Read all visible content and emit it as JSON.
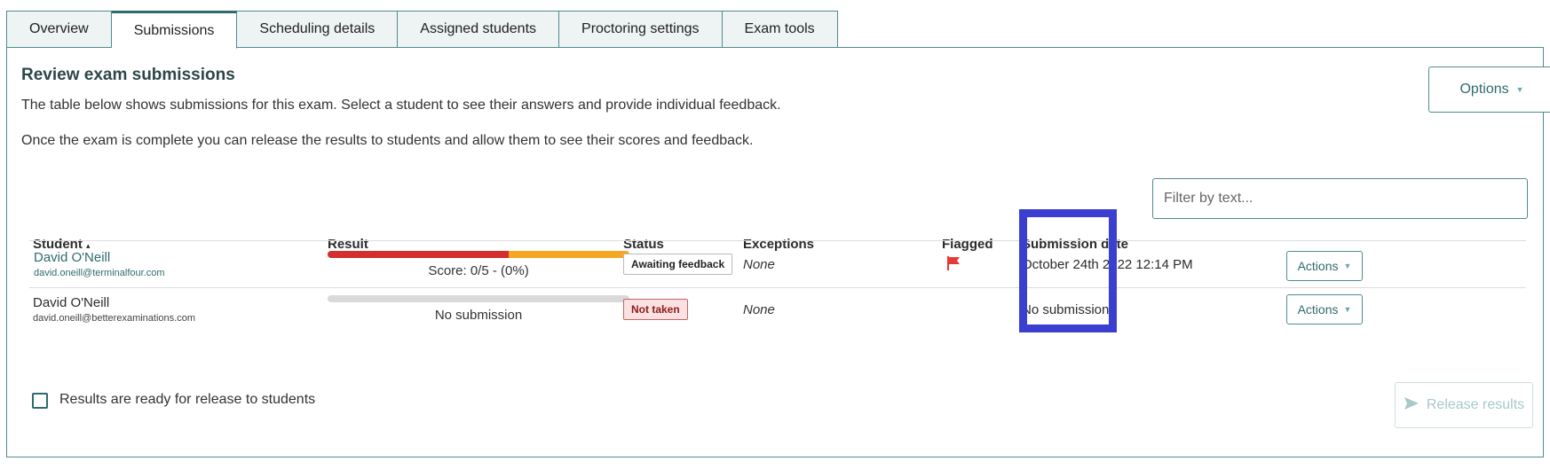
{
  "tabs": [
    {
      "label": "Overview"
    },
    {
      "label": "Submissions"
    },
    {
      "label": "Scheduling details"
    },
    {
      "label": "Assigned students"
    },
    {
      "label": "Proctoring settings"
    },
    {
      "label": "Exam tools"
    }
  ],
  "active_tab": "Submissions",
  "header": {
    "title": "Review exam submissions",
    "description1": "The table below shows submissions for this exam. Select a student to see their answers and provide individual feedback.",
    "description2": "Once the exam is complete you can release the results to students and allow them to see their scores and feedback.",
    "options_label": "Options"
  },
  "filter": {
    "placeholder": "Filter by text..."
  },
  "table": {
    "columns": {
      "student": "Student",
      "student_sort_icon": "▴",
      "result": "Result",
      "status": "Status",
      "exceptions": "Exceptions",
      "flagged": "Flagged",
      "submission_date": "Submission date"
    },
    "rows": [
      {
        "name": "David O'Neill",
        "email": "david.oneill@terminalfour.com",
        "result_text": "Score: 0/5 - (0%)",
        "result_bar": {
          "red_fraction": 0.6,
          "orange_fraction": 0.4
        },
        "status": "Awaiting feedback",
        "exceptions": "None",
        "flagged": true,
        "submission_date": "October 24th 2022 12:14 PM",
        "actions_label": "Actions"
      },
      {
        "name": "David O'Neill",
        "email": "david.oneill@betterexaminations.com",
        "result_text": "No submission",
        "result_bar": {
          "red_fraction": 0,
          "orange_fraction": 0
        },
        "status": "Not taken",
        "exceptions": "None",
        "flagged": false,
        "submission_date": "No submission",
        "actions_label": "Actions"
      }
    ]
  },
  "footer": {
    "checkbox_label": "Results are ready for release to students",
    "release_label": "Release results"
  },
  "colors": {
    "accent": "#2f6b6e",
    "bar_red": "#d32f2f",
    "bar_orange": "#f5a623",
    "bar_empty": "#d9d9d9",
    "flag": "#e53935",
    "highlight": "#3b3fcf"
  },
  "icons": {
    "flag": "flag-icon",
    "caret": "caret-down-icon",
    "send": "send-icon",
    "sort": "sort-asc-icon"
  }
}
